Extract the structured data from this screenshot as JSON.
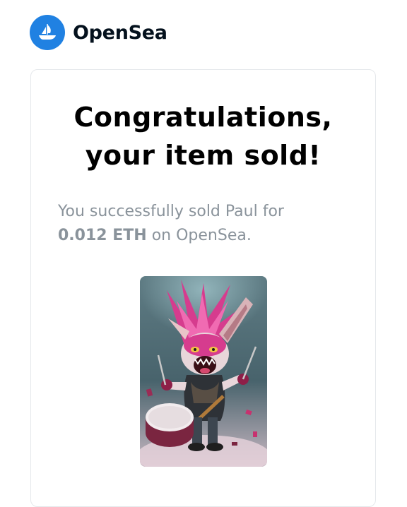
{
  "brand": {
    "name": "OpenSea",
    "logo_icon": "opensea-boat-icon",
    "color": "#2081e2"
  },
  "card": {
    "title_line1": "Congratulations,",
    "title_line2": "your item sold!",
    "message_prefix": "You successfully sold Paul for",
    "price": "0.012 ETH",
    "message_suffix": " on OpenSea.",
    "image_icon": "punk-rabbit-drummer-nft-image"
  },
  "colors": {
    "text_muted": "#8a939b",
    "border": "#e5e8eb",
    "nft_pink": "#d63c8e"
  }
}
